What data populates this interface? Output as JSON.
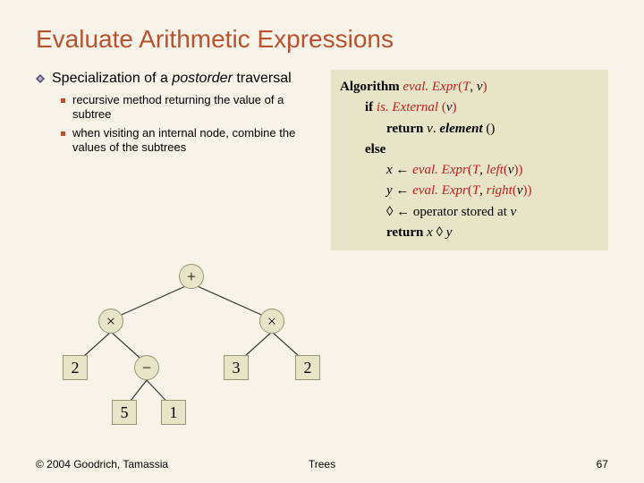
{
  "title": "Evaluate Arithmetic Expressions",
  "main_bullet": {
    "part1": "Specialization of a ",
    "italic": "postorder",
    "part2": " traversal"
  },
  "sub_bullets": [
    "recursive method returning the value of a subtree",
    "when visiting an internal node, combine the values of the subtrees"
  ],
  "algorithm": {
    "l0_kw": "Algorithm",
    "l0_fn": "eval. Expr",
    "l0_args_T": "T",
    "l0_args_v": "v",
    "l1_kw": "if",
    "l1_fn": "is. External",
    "l1_args_v": "v",
    "l2_kw": "return",
    "l2_v": "v",
    "l2_m": "element",
    "l3_kw": "else",
    "l4_x": "x",
    "l4_fn": "eval. Expr",
    "l4_T": "T",
    "l4_left": "left",
    "l4_v": "v",
    "l5_y": "y",
    "l5_fn": "eval. Expr",
    "l5_T": "T",
    "l5_right": "right",
    "l5_v": "v",
    "l6_op": "◊",
    "l6_rest": "operator stored at",
    "l6_v": "v",
    "l7_kw": "return",
    "l7_x": "x",
    "l7_op": "◊",
    "l7_y": "y",
    "arrow": "←"
  },
  "tree": {
    "root": "+",
    "n_l": "×",
    "n_r": "×",
    "n_ll": "2",
    "n_lr": "−",
    "n_rl": "3",
    "n_rr": "2",
    "n_lrl": "5",
    "n_lrr": "1"
  },
  "footer": {
    "copyright": "© 2004 Goodrich, Tamassia",
    "center": "Trees",
    "page": "67"
  }
}
